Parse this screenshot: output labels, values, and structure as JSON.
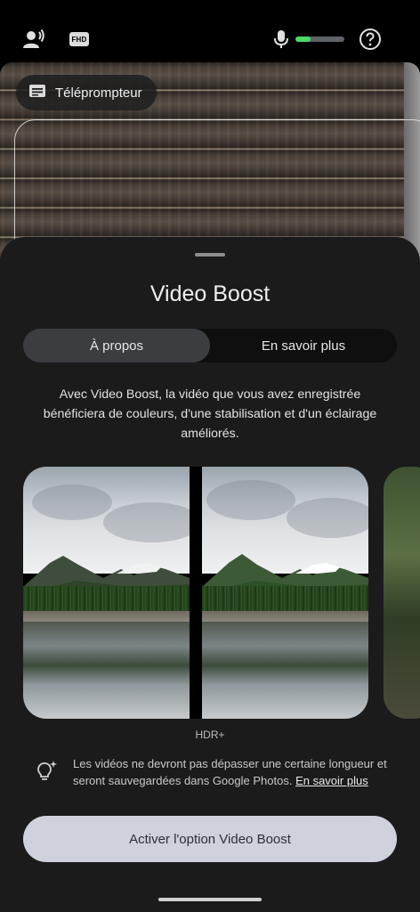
{
  "topbar": {
    "left_icons": [
      "voice-caption-icon",
      "fhd-icon"
    ],
    "fhd_label": "FHD",
    "mic_icon": "microphone-icon",
    "audio_level": 0.3,
    "audio_level_color": "#4cd964",
    "help_icon": "help-icon"
  },
  "viewfinder": {
    "teleprompter_label": "Téléprompteur",
    "teleprompter_icon": "subtitles-icon"
  },
  "sheet": {
    "title": "Video Boost",
    "tabs": [
      {
        "label": "À propos",
        "selected": true
      },
      {
        "label": "En savoir plus",
        "selected": false
      }
    ],
    "description": "Avec Video Boost, la vidéo que vous avez enregistrée bénéficiera de couleurs, d'une stabilisation et d'un éclairage améliorés.",
    "carousel": {
      "caption": "HDR+"
    },
    "tip": {
      "icon": "lightbulb-sparkle-icon",
      "text": "Les vidéos ne devront pas dépasser une certaine longueur et seront sauvegardées dans Google Photos. ",
      "link": "En savoir plus"
    },
    "cta_label": "Activer l'option Video Boost"
  },
  "colors": {
    "sheet_bg": "#1b1b1b",
    "cta_bg": "#cfd2dd",
    "active_tab_bg": "#3c3d41"
  }
}
